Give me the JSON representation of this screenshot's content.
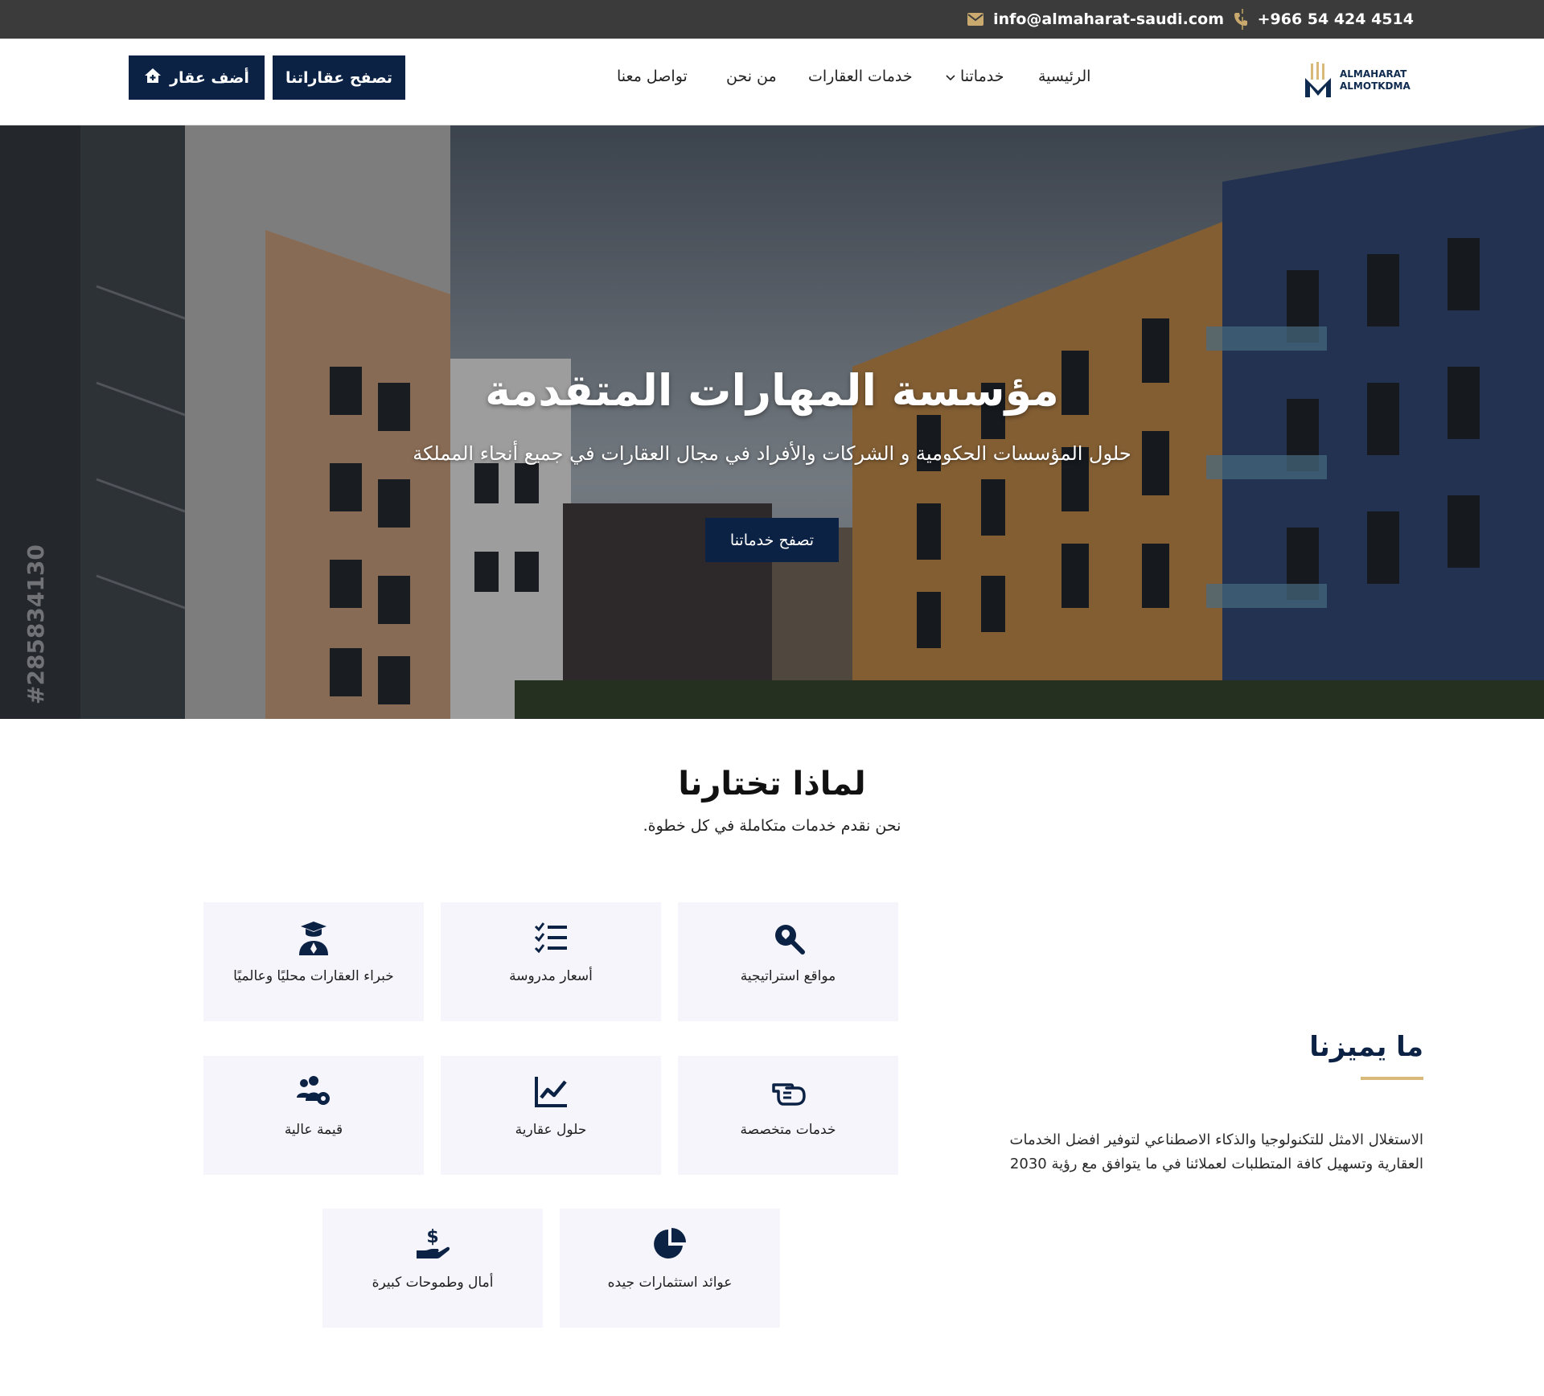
{
  "topbar": {
    "email": "info@almaharat-saudi.com",
    "phone": "+966 54 424 4514",
    "email_icon": "envelope-icon",
    "phone_icon": "phone-icon"
  },
  "header": {
    "logo": {
      "line1": "ALMAHARAT",
      "line2": "ALMOTKDMA"
    },
    "nav": {
      "home": "الرئيسية",
      "services": "خدماتنا",
      "real_estate_services": "خدمات العقارات",
      "about": "من نحن",
      "contact": "تواصل معنا"
    },
    "buttons": {
      "browse_properties": "تصفح عقاراتنا",
      "add_property": "أضف عقار"
    }
  },
  "hero": {
    "title": "مؤسسة المهارات المتقدمة",
    "subtitle": "حلول المؤسسات الحكومية و الشركات والأفراد في مجال العقارات في جميع أنحاء المملكة",
    "button": "تصفح خدماتنا",
    "watermark": "#285834130"
  },
  "why": {
    "title": "لماذا تختارنا",
    "subtitle": "نحن نقدم خدمات متكاملة في كل خطوة.",
    "cards": [
      {
        "label": "مواقع استراتيجية",
        "icon": "location-search-icon"
      },
      {
        "label": "أسعار مدروسة",
        "icon": "checklist-icon"
      },
      {
        "label": "خبراء العقارات محليًا وعالميًا",
        "icon": "graduate-icon"
      },
      {
        "label": "خدمات متخصصة",
        "icon": "pointing-hand-icon"
      },
      {
        "label": "حلول عقارية",
        "icon": "line-chart-icon"
      },
      {
        "label": "قيمة عالية",
        "icon": "users-gear-icon"
      },
      {
        "label": "عوائد استثمارات جيده",
        "icon": "pie-chart-icon"
      },
      {
        "label": "أمال وطموحات كبيرة",
        "icon": "hand-dollar-icon"
      }
    ]
  },
  "features": {
    "title": "ما يميزنا",
    "text": "الاستغلال الامثل للتكنولوجيا والذكاء الاصطناعي لتوفير افضل الخدمات العقارية وتسهيل كافة المتطلبات لعملائنا في ما يتوافق مع رؤية 2030"
  },
  "colors": {
    "navy": "#0b2245",
    "gold": "#d9b978",
    "topbar": "#3b3b3b",
    "card_bg": "#f7f5fc"
  }
}
